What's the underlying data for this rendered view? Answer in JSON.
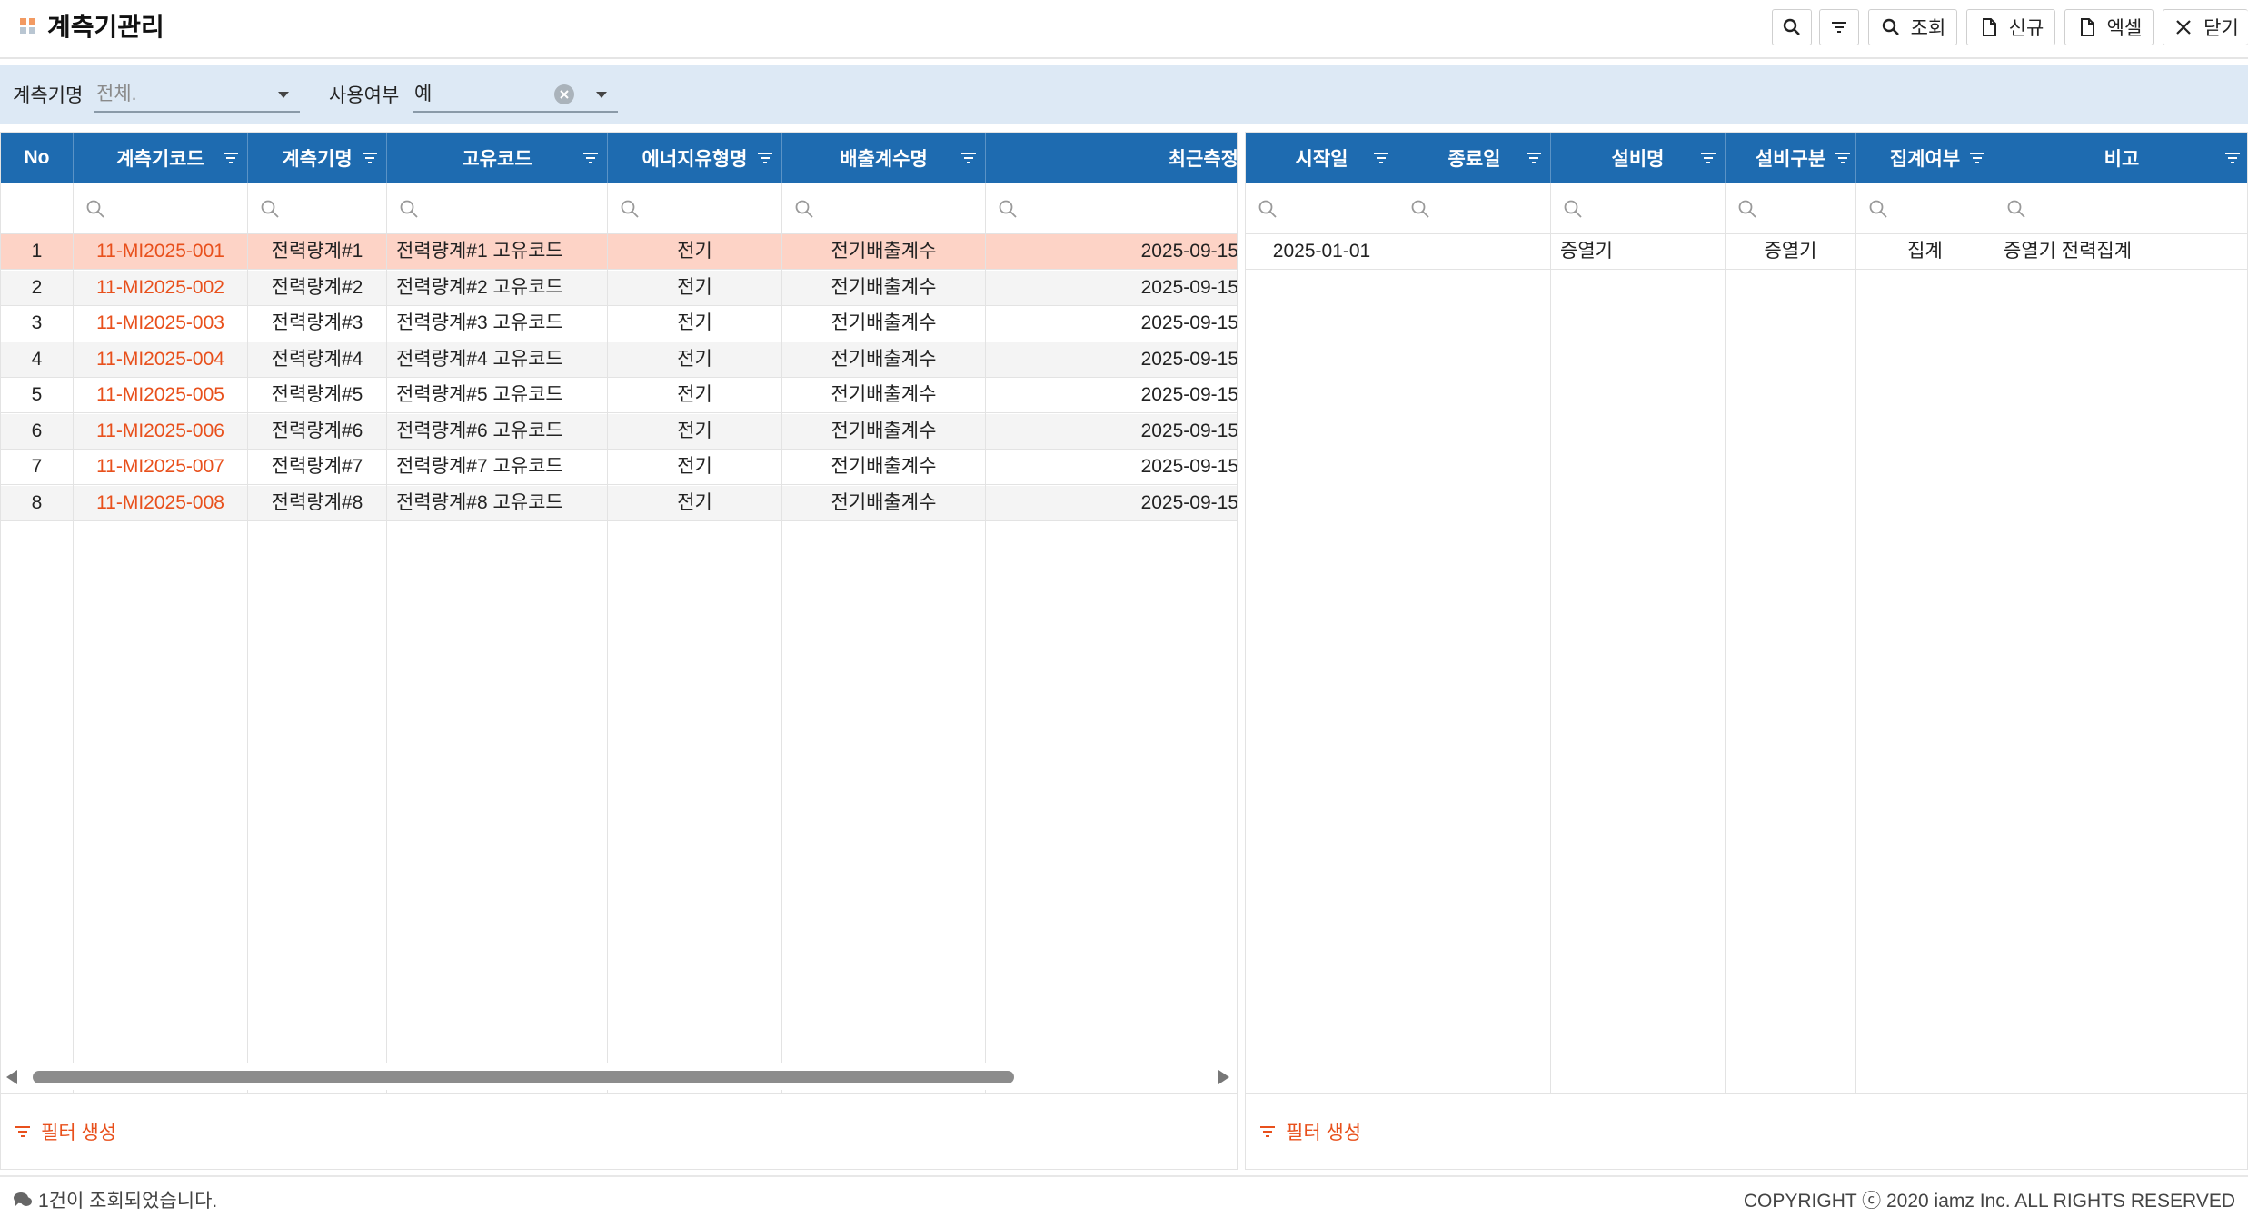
{
  "header": {
    "title": "계측기관리",
    "buttons": {
      "search_label": "조회",
      "new_label": "신규",
      "excel_label": "엑셀",
      "close_label": "닫기"
    }
  },
  "filters": {
    "meter_name_label": "계측기명",
    "meter_name_value": "전체.",
    "use_yn_label": "사용여부",
    "use_yn_value": "예"
  },
  "left_grid": {
    "columns": [
      "No",
      "계측기코드",
      "계측기명",
      "고유코드",
      "에너지유형명",
      "배출계수명",
      "최근측정"
    ],
    "rows": [
      {
        "no": "1",
        "code": "11-MI2025-001",
        "name": "전력량계#1",
        "unique": "전력량계#1 고유코드",
        "energy": "전기",
        "factor": "전기배출계수",
        "date": "2025-09-15"
      },
      {
        "no": "2",
        "code": "11-MI2025-002",
        "name": "전력량계#2",
        "unique": "전력량계#2 고유코드",
        "energy": "전기",
        "factor": "전기배출계수",
        "date": "2025-09-15"
      },
      {
        "no": "3",
        "code": "11-MI2025-003",
        "name": "전력량계#3",
        "unique": "전력량계#3 고유코드",
        "energy": "전기",
        "factor": "전기배출계수",
        "date": "2025-09-15"
      },
      {
        "no": "4",
        "code": "11-MI2025-004",
        "name": "전력량계#4",
        "unique": "전력량계#4 고유코드",
        "energy": "전기",
        "factor": "전기배출계수",
        "date": "2025-09-15"
      },
      {
        "no": "5",
        "code": "11-MI2025-005",
        "name": "전력량계#5",
        "unique": "전력량계#5 고유코드",
        "energy": "전기",
        "factor": "전기배출계수",
        "date": "2025-09-15"
      },
      {
        "no": "6",
        "code": "11-MI2025-006",
        "name": "전력량계#6",
        "unique": "전력량계#6 고유코드",
        "energy": "전기",
        "factor": "전기배출계수",
        "date": "2025-09-15"
      },
      {
        "no": "7",
        "code": "11-MI2025-007",
        "name": "전력량계#7",
        "unique": "전력량계#7 고유코드",
        "energy": "전기",
        "factor": "전기배출계수",
        "date": "2025-09-15"
      },
      {
        "no": "8",
        "code": "11-MI2025-008",
        "name": "전력량계#8",
        "unique": "전력량계#8 고유코드",
        "energy": "전기",
        "factor": "전기배출계수",
        "date": "2025-09-15"
      }
    ],
    "filter_create_label": "필터 생성"
  },
  "right_grid": {
    "columns": [
      "시작일",
      "종료일",
      "설비명",
      "설비구분",
      "집계여부",
      "비고"
    ],
    "rows": [
      {
        "start": "2025-01-01",
        "end": "",
        "equip": "증열기",
        "equip_type": "증열기",
        "agg": "집계",
        "note": "증열기 전력집계"
      }
    ],
    "filter_create_label": "필터 생성"
  },
  "status": {
    "message": "1건이 조회되었습니다.",
    "copyright": "COPYRIGHT ⓒ 2020 iamz Inc. ALL RIGHTS RESERVED"
  },
  "colors": {
    "header_blue": "#1e6bb0",
    "accent_orange": "#e8501c",
    "selected_row": "#fdd3c6",
    "filter_bar": "#dde9f5"
  }
}
